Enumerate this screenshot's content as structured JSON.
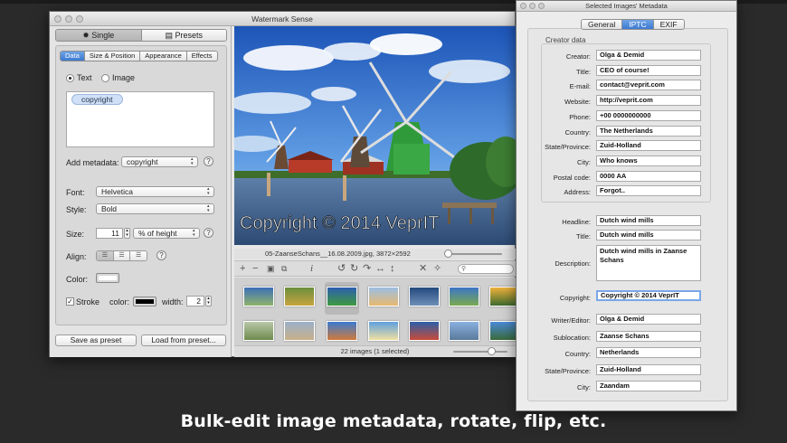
{
  "main_window": {
    "title": "Watermark Sense",
    "mode_tabs": [
      {
        "label": "✸ Single"
      },
      {
        "label": "▤ Presets"
      }
    ],
    "panel_tabs": [
      "Data",
      "Size & Position",
      "Appearance",
      "Effects"
    ],
    "type_options": [
      "Text",
      "Image"
    ],
    "watermark_token": "copyright",
    "add_metadata_label": "Add metadata:",
    "add_metadata_value": "copyright",
    "font_label": "Font:",
    "font_value": "Helvetica",
    "style_label": "Style:",
    "style_value": "Bold",
    "size_label": "Size:",
    "size_value": "11",
    "size_unit": "% of height",
    "align_label": "Align:",
    "color_label": "Color:",
    "text_color": "#ffffff",
    "stroke_label": "Stroke",
    "stroke_color_label": "color:",
    "stroke_color": "#000000",
    "width_label": "width:",
    "width_value": "2",
    "save_preset_label": "Save as preset",
    "load_preset_label": "Load from preset...",
    "help_symbol": "?"
  },
  "photo": {
    "watermark_text": "Copyright © 2014 VeprIT",
    "filename": "05-ZaanseSchans__16.08.2009.jpg,  3872×2592"
  },
  "toolbar": {
    "icons": [
      "plus-icon",
      "minus-icon",
      "save-icon",
      "copy-icon",
      "info-icon",
      "rotate-left-icon",
      "rotate-right-icon",
      "redo-icon",
      "flip-horizontal-icon",
      "flip-vertical-icon",
      "remove-icon",
      "clear-all-icon",
      "search-icon"
    ]
  },
  "status": {
    "text": "22 images (1 selected)"
  },
  "metadata_window": {
    "title": "Selected Images' Metadata",
    "tabs": [
      "General",
      "IPTC",
      "EXIF"
    ],
    "creator_group_label": "Creator data",
    "creator_fields": [
      {
        "label": "Creator:",
        "value": "Olga & Demid"
      },
      {
        "label": "Title:",
        "value": "CEO of course!"
      },
      {
        "label": "E-mail:",
        "value": "contact@veprit.com"
      },
      {
        "label": "Website:",
        "value": "http://veprit.com"
      },
      {
        "label": "Phone:",
        "value": "+00 0000000000"
      },
      {
        "label": "Country:",
        "value": "The Netherlands"
      },
      {
        "label": "State/Province:",
        "value": "Zuid-Holland"
      },
      {
        "label": "City:",
        "value": "Who knows"
      },
      {
        "label": "Postal code:",
        "value": "0000 AA"
      },
      {
        "label": "Address:",
        "value": "Forgot.."
      }
    ],
    "headline_label": "Headline:",
    "headline_value": "Dutch wind mills",
    "title_label": "Title:",
    "title_value": "Dutch wind mills",
    "description_label": "Description:",
    "description_value": "Dutch wind mills in Zaanse Schans",
    "copyright_label": "Copyright:",
    "copyright_value": "Copyright © 2014 VeprIT",
    "other_fields": [
      {
        "label": "Writer/Editor:",
        "value": "Olga & Demid"
      },
      {
        "label": "Sublocation:",
        "value": "Zaanse Schans"
      },
      {
        "label": "Country:",
        "value": "Netherlands"
      },
      {
        "label": "State/Province:",
        "value": "Zuid-Holland"
      },
      {
        "label": "City:",
        "value": "Zaandam"
      }
    ]
  },
  "caption": "Bulk-edit image metadata, rotate, flip, etc."
}
